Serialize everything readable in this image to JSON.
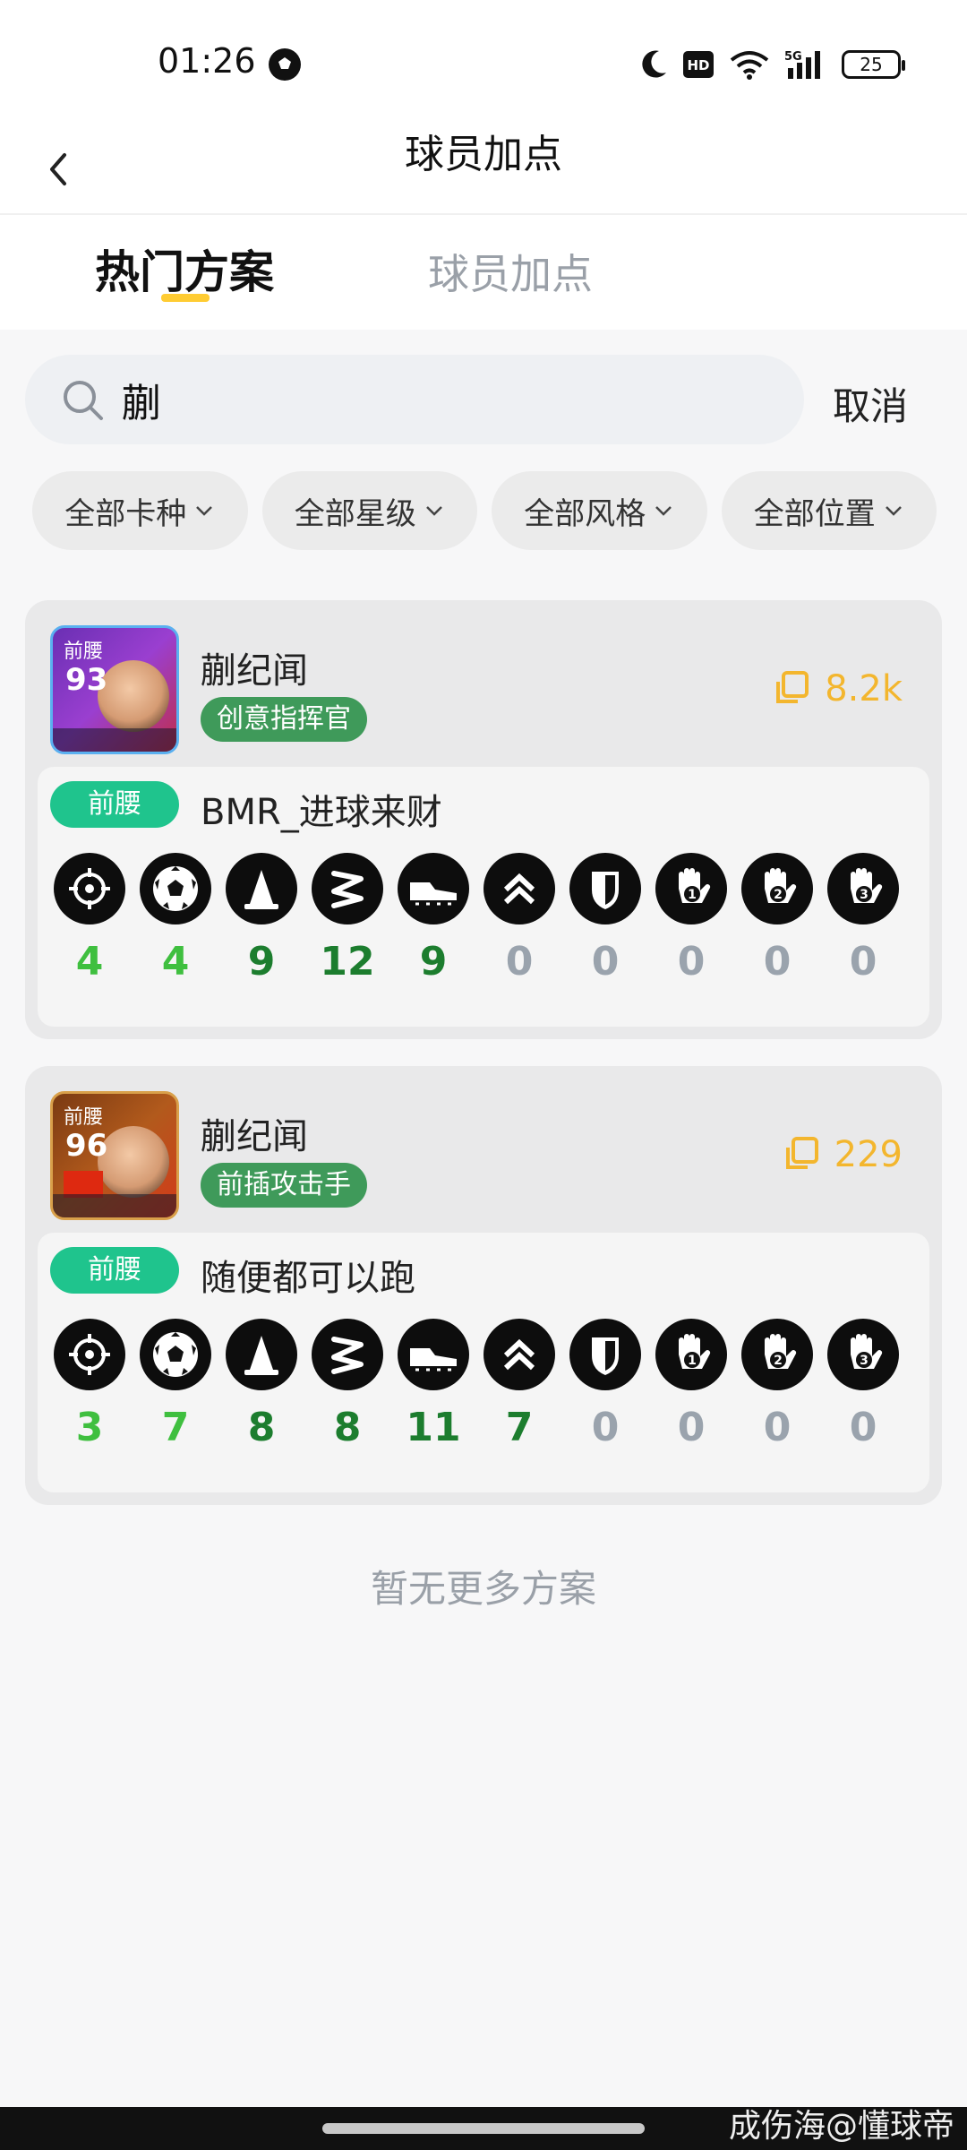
{
  "status_bar": {
    "time": "01:26",
    "battery": "25"
  },
  "header": {
    "title": "球员加点"
  },
  "tabs": [
    {
      "label": "热门方案",
      "active": true
    },
    {
      "label": "球员加点",
      "active": false
    }
  ],
  "search": {
    "value": "蒯",
    "cancel_label": "取消"
  },
  "filters": [
    "全部卡种",
    "全部星级",
    "全部风格",
    "全部位置"
  ],
  "cards": [
    {
      "avatar_position": "前腰",
      "avatar_rating": "93",
      "player_name": "蒯纪闻",
      "style": "创意指挥官",
      "copy_count": "8.2k",
      "position": "前腰",
      "plan_name": "BMR_进球来财",
      "skills": [
        "4",
        "4",
        "9",
        "12",
        "9",
        "0",
        "0",
        "0",
        "0",
        "0"
      ]
    },
    {
      "avatar_position": "前腰",
      "avatar_rating": "96",
      "player_name": "蒯纪闻",
      "style": "前插攻击手",
      "copy_count": "229",
      "position": "前腰",
      "plan_name": "随便都可以跑",
      "skills": [
        "3",
        "7",
        "8",
        "8",
        "11",
        "7",
        "0",
        "0",
        "0",
        "0"
      ]
    }
  ],
  "skill_icons": [
    "target-icon",
    "football-icon",
    "cone-icon",
    "zigzag-icon",
    "boot-icon",
    "double-chevron-icon",
    "shield-icon",
    "glove-1-icon",
    "glove-2-icon",
    "glove-3-icon"
  ],
  "empty_text": "暂无更多方案",
  "watermark": "成伤海@懂球帝",
  "colors": {
    "accent_yellow": "#ffcc33",
    "badge_green": "#3f9a5a",
    "position_teal": "#1fc48d",
    "copy_orange": "#f3b62e"
  }
}
